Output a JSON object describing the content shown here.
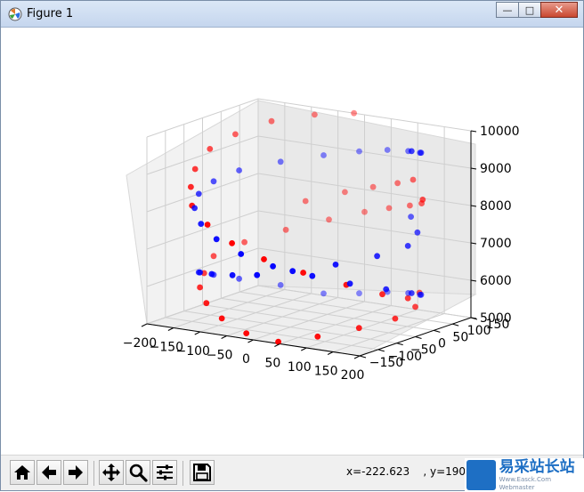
{
  "window": {
    "title": "Figure 1",
    "minimize_label": "—",
    "maximize_label": "□",
    "close_label": "✕"
  },
  "toolbar": {
    "buttons": [
      {
        "name": "home-icon"
      },
      {
        "name": "back-arrow-icon"
      },
      {
        "name": "forward-arrow-icon"
      },
      {
        "name": "pan-icon"
      },
      {
        "name": "zoom-icon"
      },
      {
        "name": "subplots-config-icon"
      },
      {
        "name": "save-icon"
      }
    ],
    "coords": "x=-222.623    , y=190.4"
  },
  "watermark": {
    "main": "易采站长站",
    "sub": "Www.Easck.Com Webmaster"
  },
  "chart_data": {
    "type": "scatter3d",
    "x_ticks": [
      "−200",
      "−150",
      "−100",
      "−50",
      "0",
      "50",
      "100",
      "150",
      "200"
    ],
    "y_ticks": [
      "−150",
      "−100",
      "−50",
      "0",
      "50",
      "100",
      "150"
    ],
    "z_ticks": [
      "5000",
      "6000",
      "7000",
      "8000",
      "9000",
      "10000"
    ],
    "xlim": [
      -200,
      200
    ],
    "ylim": [
      -150,
      150
    ],
    "zlim": [
      5000,
      10000
    ],
    "series": [
      {
        "color": "#ff0000",
        "points": [
          [
            -20,
            150,
            10000
          ],
          [
            -80,
            130,
            9900
          ],
          [
            -140,
            100,
            9700
          ],
          [
            -180,
            60,
            9400
          ],
          [
            -200,
            20,
            9100
          ],
          [
            -200,
            -20,
            8700
          ],
          [
            -180,
            -60,
            8400
          ],
          [
            -150,
            -100,
            8100
          ],
          [
            -100,
            -130,
            7800
          ],
          [
            -40,
            -150,
            7500
          ],
          [
            20,
            -150,
            7200
          ],
          [
            80,
            -130,
            6900
          ],
          [
            140,
            -100,
            6600
          ],
          [
            180,
            -60,
            6300
          ],
          [
            200,
            -20,
            6100
          ],
          [
            200,
            20,
            8600
          ],
          [
            170,
            60,
            8300
          ],
          [
            120,
            100,
            8000
          ],
          [
            60,
            130,
            7700
          ],
          [
            0,
            150,
            7400
          ],
          [
            -60,
            140,
            7100
          ],
          [
            -120,
            110,
            6800
          ],
          [
            -170,
            70,
            6500
          ],
          [
            -200,
            30,
            6200
          ],
          [
            -190,
            -10,
            5900
          ],
          [
            -170,
            -50,
            5700
          ],
          [
            -130,
            -90,
            5500
          ],
          [
            -80,
            -120,
            5300
          ],
          [
            -20,
            -140,
            5100
          ],
          [
            40,
            -140,
            5000
          ],
          [
            100,
            -120,
            5200
          ],
          [
            150,
            -80,
            5400
          ],
          [
            190,
            -40,
            5600
          ],
          [
            200,
            0,
            5800
          ],
          [
            180,
            40,
            6000
          ],
          [
            140,
            80,
            8800
          ],
          [
            90,
            110,
            8500
          ],
          [
            30,
            130,
            8200
          ],
          [
            -30,
            140,
            7900
          ],
          [
            -90,
            120,
            7600
          ]
        ]
      },
      {
        "color": "#0000ff",
        "points": [
          [
            200,
            -10,
            10000
          ],
          [
            190,
            30,
            9800
          ],
          [
            160,
            70,
            9600
          ],
          [
            110,
            110,
            9400
          ],
          [
            50,
            140,
            9200
          ],
          [
            -10,
            150,
            9000
          ],
          [
            -70,
            140,
            8800
          ],
          [
            -130,
            110,
            8600
          ],
          [
            -180,
            70,
            8400
          ],
          [
            -200,
            30,
            8200
          ],
          [
            -200,
            -10,
            8000
          ],
          [
            -180,
            -50,
            7800
          ],
          [
            -140,
            -90,
            7600
          ],
          [
            -90,
            -120,
            7400
          ],
          [
            -30,
            -140,
            7200
          ],
          [
            30,
            -140,
            7000
          ],
          [
            90,
            -120,
            6800
          ],
          [
            140,
            -90,
            6600
          ],
          [
            180,
            -50,
            6400
          ],
          [
            200,
            -10,
            6200
          ],
          [
            190,
            30,
            6000
          ],
          [
            160,
            70,
            5800
          ],
          [
            110,
            110,
            5600
          ],
          [
            50,
            140,
            5400
          ],
          [
            -10,
            150,
            5200
          ],
          [
            -70,
            140,
            5100
          ],
          [
            -130,
            110,
            5300
          ],
          [
            -180,
            70,
            5500
          ],
          [
            -200,
            30,
            5700
          ],
          [
            -200,
            -10,
            5900
          ],
          [
            -170,
            -50,
            6100
          ],
          [
            -120,
            -90,
            6300
          ],
          [
            -60,
            -120,
            6500
          ],
          [
            0,
            -140,
            6700
          ],
          [
            60,
            -130,
            6900
          ],
          [
            120,
            -100,
            7100
          ],
          [
            170,
            -60,
            7300
          ],
          [
            200,
            -20,
            7500
          ],
          [
            190,
            20,
            7700
          ],
          [
            150,
            60,
            7900
          ]
        ]
      }
    ]
  }
}
